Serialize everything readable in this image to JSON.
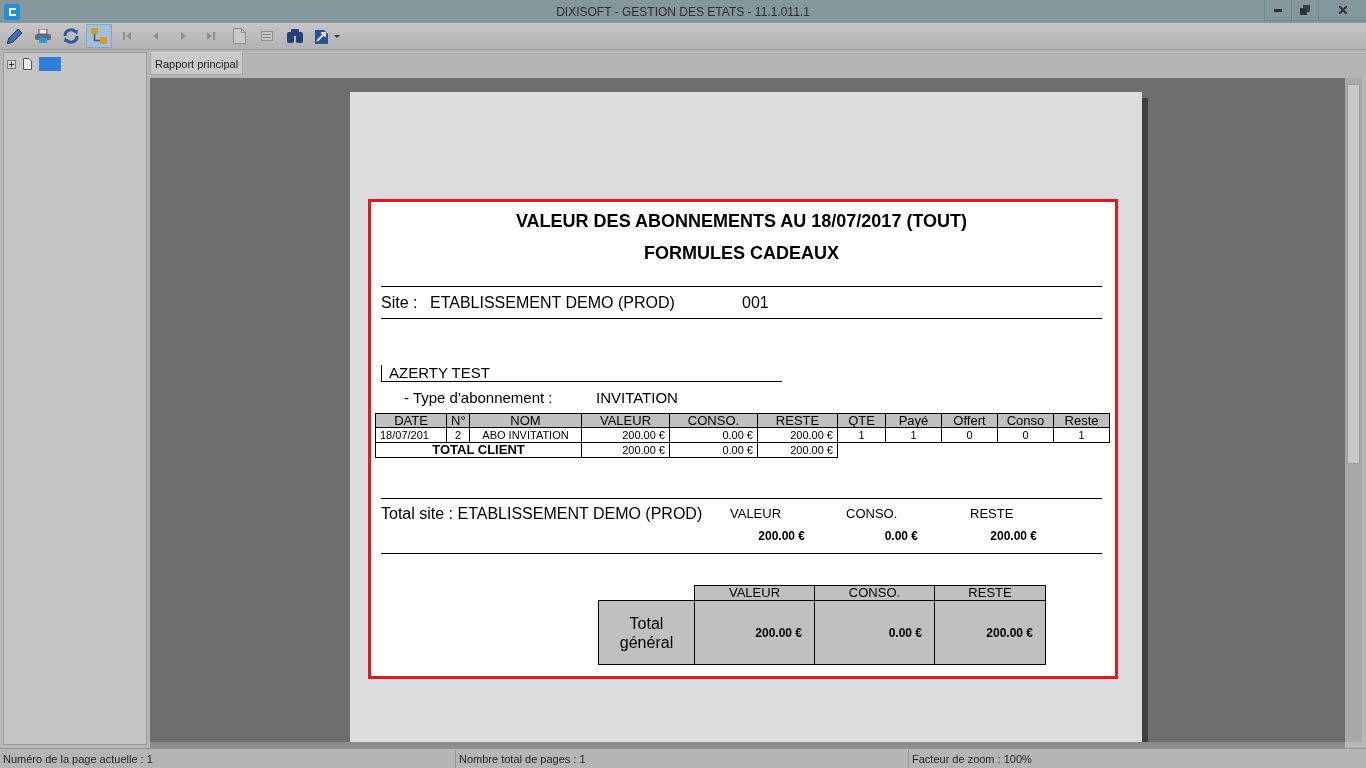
{
  "window": {
    "title": "DIXISOFT - GESTION DES ETATS - 11.1.011.1"
  },
  "toolbar": [
    {
      "selected": false,
      "disabled": false,
      "dropdown": false
    },
    {
      "selected": false,
      "disabled": false,
      "dropdown": false
    },
    {
      "selected": false,
      "disabled": false,
      "dropdown": false
    },
    {
      "selected": true,
      "disabled": false,
      "dropdown": false
    },
    {
      "selected": false,
      "disabled": true,
      "dropdown": false
    },
    {
      "selected": false,
      "disabled": true,
      "dropdown": false
    },
    {
      "selected": false,
      "disabled": true,
      "dropdown": false
    },
    {
      "selected": false,
      "disabled": true,
      "dropdown": false
    },
    {
      "selected": false,
      "disabled": true,
      "dropdown": false
    },
    {
      "selected": false,
      "disabled": true,
      "dropdown": false
    },
    {
      "selected": false,
      "disabled": false,
      "dropdown": false
    },
    {
      "selected": false,
      "disabled": false,
      "dropdown": true
    }
  ],
  "tree": [
    {
      "expanded": false,
      "selected": true
    }
  ],
  "tabs": [
    {
      "label": "Rapport principal",
      "selected": true
    }
  ],
  "report": {
    "title": "VALEUR DES ABONNEMENTS AU 18/07/2017 (TOUT)",
    "subtitle": "FORMULES CADEAUX",
    "site": {
      "label": "Site :",
      "name": "ETABLISSEMENT DEMO (PROD)",
      "code": "001"
    },
    "client": {
      "name": "AZERTY TEST",
      "type_label": "- Type d'abonnement :",
      "type_value": "INVITATION"
    },
    "table": {
      "columns": [
        "DATE",
        "N°",
        "NOM",
        "VALEUR",
        "CONSO.",
        "RESTE",
        "QTE",
        "Payé",
        "Offert",
        "Conso",
        "Reste"
      ],
      "rows": [
        [
          "18/07/201",
          "2",
          "ABO INVITATION",
          "200.00 €",
          "0.00 €",
          "200.00 €",
          "1",
          "1",
          "0",
          "0",
          "1"
        ]
      ],
      "total": {
        "label": "TOTAL CLIENT",
        "values": [
          "200.00 €",
          "0.00 €",
          "200.00 €"
        ]
      }
    },
    "site_total": {
      "label": "Total site : ETABLISSEMENT DEMO (PROD)",
      "columns": [
        "VALEUR",
        "CONSO.",
        "RESTE"
      ],
      "values": [
        "200.00 €",
        "0.00 €",
        "200.00 €"
      ]
    },
    "grand_total": {
      "label": "Total général",
      "columns": [
        "VALEUR",
        "CONSO.",
        "RESTE"
      ],
      "values": [
        "200.00 €",
        "0.00 €",
        "200.00 €"
      ]
    }
  },
  "status_bar": [
    "Numéro de la page actuelle : 1",
    "Nombre total de pages : 1",
    "Facteur de zoom : 100%"
  ]
}
